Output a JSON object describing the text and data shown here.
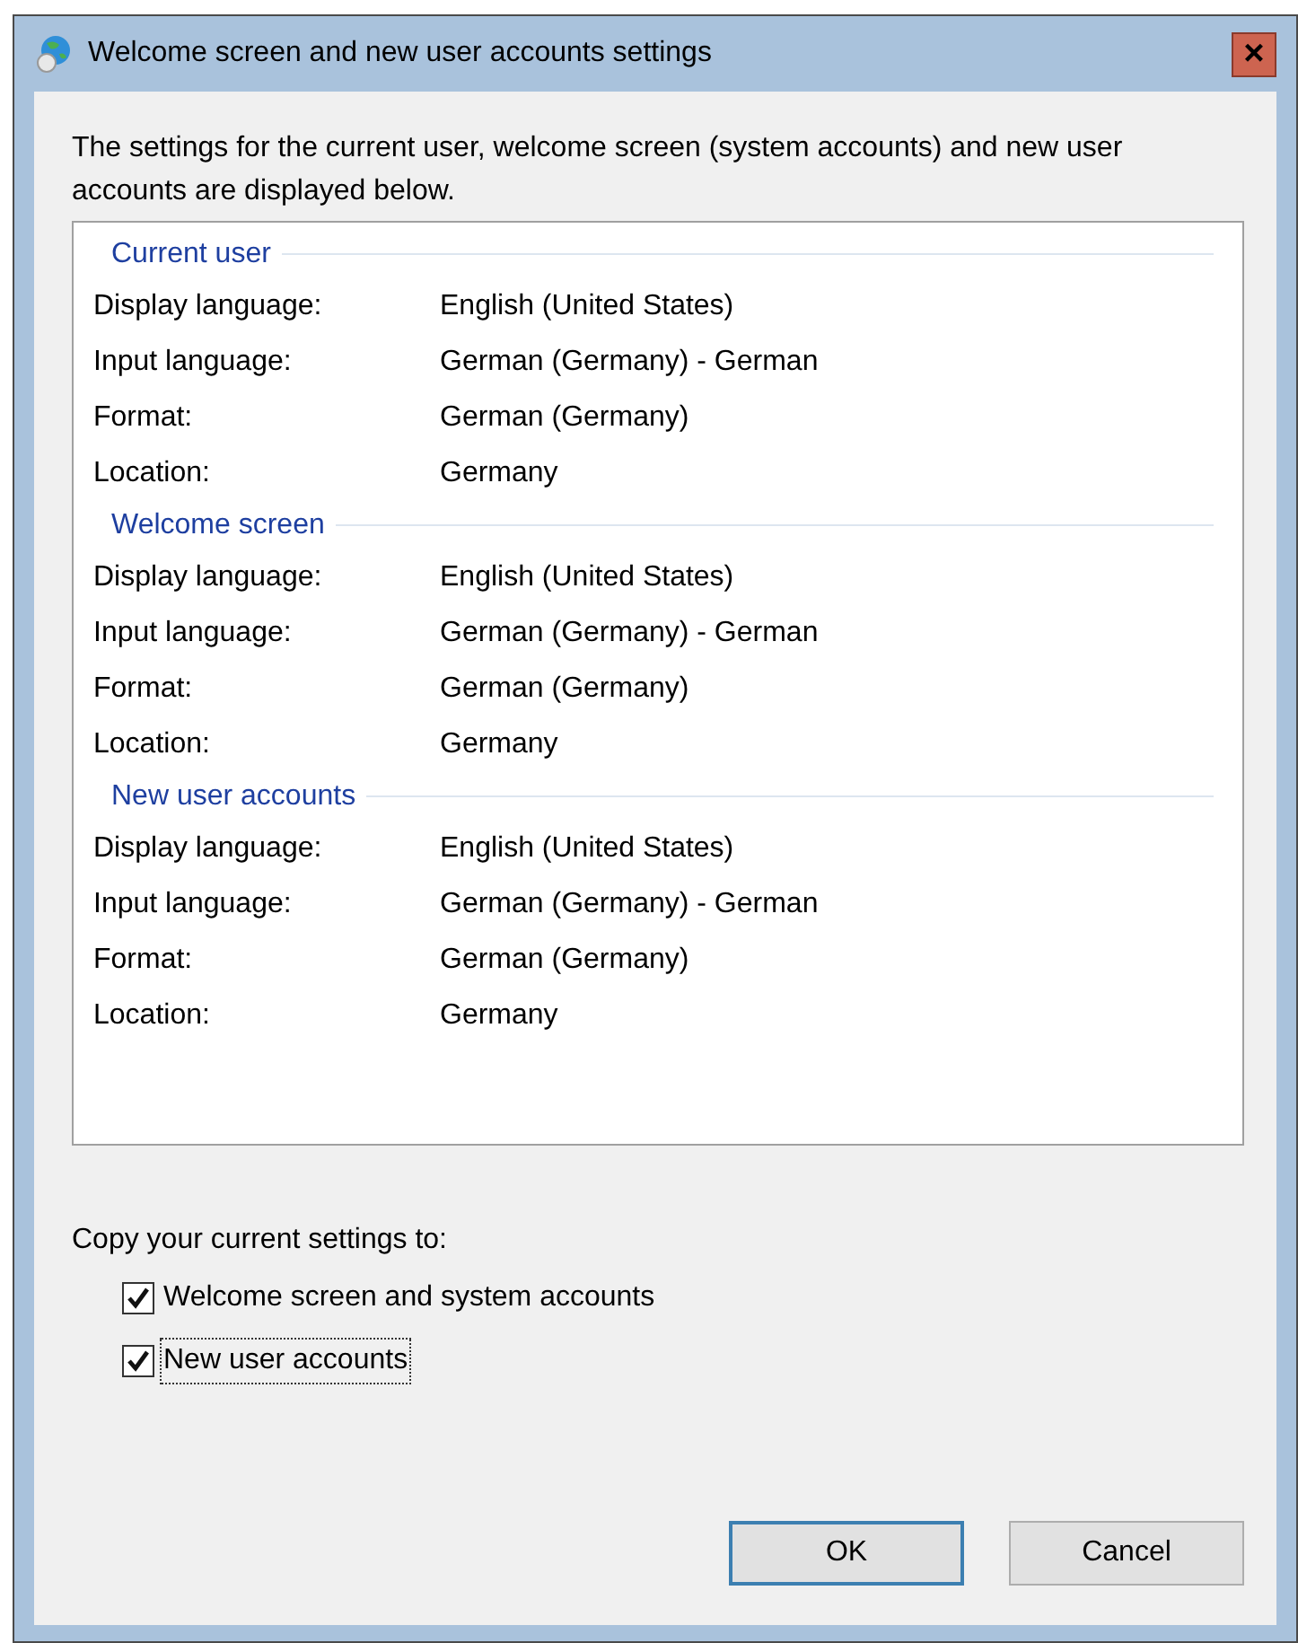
{
  "window": {
    "title": "Welcome screen and new user accounts settings",
    "close_label": "×"
  },
  "intro": "The settings for the current user, welcome screen (system accounts) and new user accounts are displayed below.",
  "sections": [
    {
      "title": "Current user",
      "rows": [
        {
          "label": "Display language:",
          "value": "English (United States)"
        },
        {
          "label": "Input language:",
          "value": "German (Germany) - German"
        },
        {
          "label": "Format:",
          "value": "German (Germany)"
        },
        {
          "label": "Location:",
          "value": "Germany"
        }
      ]
    },
    {
      "title": "Welcome screen",
      "rows": [
        {
          "label": "Display language:",
          "value": "English (United States)"
        },
        {
          "label": "Input language:",
          "value": "German (Germany) - German"
        },
        {
          "label": "Format:",
          "value": "German (Germany)"
        },
        {
          "label": "Location:",
          "value": "Germany"
        }
      ]
    },
    {
      "title": "New user accounts",
      "rows": [
        {
          "label": "Display language:",
          "value": "English (United States)"
        },
        {
          "label": "Input language:",
          "value": "German (Germany) - German"
        },
        {
          "label": "Format:",
          "value": "German (Germany)"
        },
        {
          "label": "Location:",
          "value": "Germany"
        }
      ]
    }
  ],
  "copy_label": "Copy your current settings to:",
  "checkboxes": [
    {
      "label": "Welcome screen and system accounts",
      "checked": true,
      "focused": false
    },
    {
      "label": "New user accounts",
      "checked": true,
      "focused": true
    }
  ],
  "buttons": [
    {
      "label": "OK",
      "default": true
    },
    {
      "label": "Cancel",
      "default": false
    }
  ]
}
